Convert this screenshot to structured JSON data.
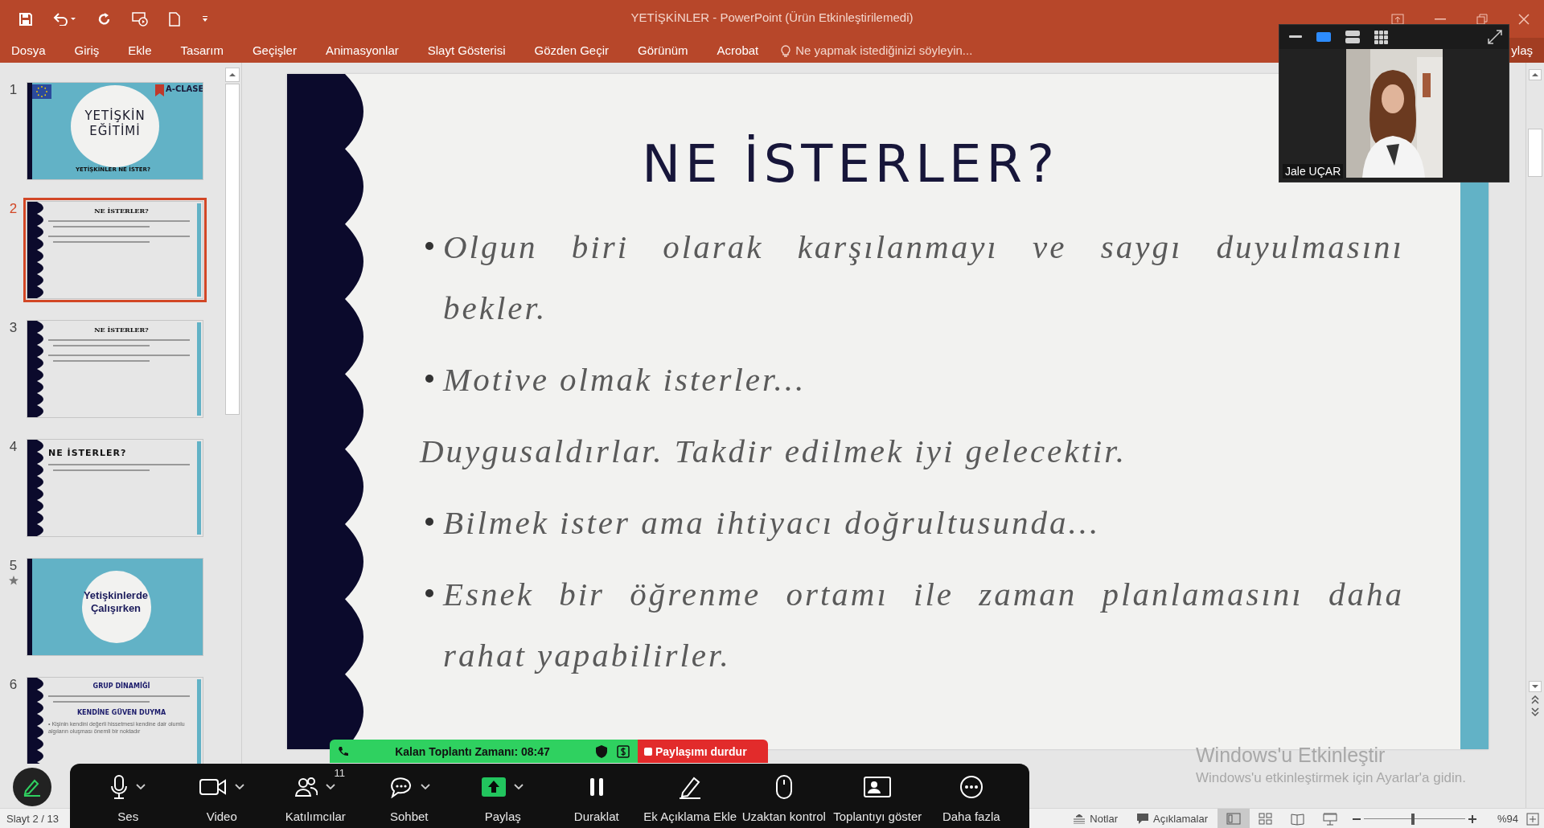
{
  "window": {
    "title": "YETİŞKİNLER - PowerPoint (Ürün Etkinleştirilemedi)"
  },
  "ribbon_tabs": [
    {
      "label": "Dosya"
    },
    {
      "label": "Giriş"
    },
    {
      "label": "Ekle"
    },
    {
      "label": "Tasarım"
    },
    {
      "label": "Geçişler"
    },
    {
      "label": "Animasyonlar"
    },
    {
      "label": "Slayt Gösterisi"
    },
    {
      "label": "Gözden Geçir"
    },
    {
      "label": "Görünüm"
    },
    {
      "label": "Acrobat"
    }
  ],
  "tell_me": {
    "placeholder": "Ne yapmak istediğinizi söyleyin..."
  },
  "share_button": "ylaş",
  "thumbnails": [
    {
      "number": "1",
      "kind": "title",
      "selected": false,
      "title_lines": [
        "YETİŞKİN",
        "EĞİTİMİ"
      ],
      "logo": "A-CLASE",
      "footer": "YETİŞKİNLER NE İSTER?"
    },
    {
      "number": "2",
      "kind": "content",
      "selected": true,
      "blocks": [
        {
          "kind": "heading-script",
          "text": "NE İSTERLER?"
        },
        {
          "kind": "lines"
        },
        {
          "kind": "lines"
        }
      ]
    },
    {
      "number": "3",
      "kind": "content",
      "selected": false,
      "blocks": [
        {
          "kind": "heading-script",
          "text": "NE İSTERLER?"
        },
        {
          "kind": "lines"
        },
        {
          "kind": "lines"
        }
      ]
    },
    {
      "number": "4",
      "kind": "content",
      "selected": false,
      "blocks": [
        {
          "kind": "heading-left",
          "text": "NE İSTERLER?"
        },
        {
          "kind": "lines"
        }
      ]
    },
    {
      "number": "5",
      "kind": "section",
      "selected": false,
      "animated": true,
      "title_lines": [
        "Yetişkinlerde",
        "Çalışırken"
      ]
    },
    {
      "number": "6",
      "kind": "content",
      "selected": false,
      "blocks": [
        {
          "kind": "heading-bold",
          "text": "GRUP DİNAMİĞİ"
        },
        {
          "kind": "lines"
        },
        {
          "kind": "heading-bold",
          "text": "KENDİNE GÜVEN DUYMA"
        },
        {
          "kind": "text",
          "text": "• Kişinin kendini değerli hissetmesi kendine dair olumlu algıların oluşması önemli bir noktadır"
        }
      ]
    }
  ],
  "slide": {
    "title": "NE İSTERLER?",
    "paragraphs": [
      {
        "kind": "bullet",
        "lines": [
          "Olgun biri olarak karşılanmayı ve saygı duyulmasını",
          "bekler."
        ]
      },
      {
        "kind": "bullet",
        "lines": [
          "Motive olmak isterler..."
        ]
      },
      {
        "kind": "plain",
        "lines": [
          "Duygusaldırlar. Takdir edilmek iyi gelecektir."
        ]
      },
      {
        "kind": "bullet",
        "lines": [
          "Bilmek ister ama ihtiyacı doğrultusunda..."
        ]
      },
      {
        "kind": "bullet",
        "lines": [
          "Esnek bir öğrenme ortamı ile zaman planlamasını daha",
          "rahat yapabilirler."
        ]
      }
    ]
  },
  "video": {
    "name": "Jale UÇAR",
    "layouts": [
      {
        "kind": "minimize",
        "selected": false
      },
      {
        "kind": "speaker",
        "selected": true
      },
      {
        "kind": "stack",
        "selected": false
      },
      {
        "kind": "grid",
        "selected": false
      }
    ]
  },
  "meeting_bar": {
    "timer": "Kalan Toplantı Zamanı: 08:47",
    "stop_share": "Paylaşımı durdur"
  },
  "toolbar": [
    {
      "kind": "mic",
      "label": "Ses",
      "menu": true
    },
    {
      "kind": "camera",
      "label": "Video",
      "menu": true
    },
    {
      "kind": "people",
      "label": "Katılımcılar",
      "count": "11",
      "menu": true
    },
    {
      "kind": "chat",
      "label": "Sohbet",
      "menu": true
    },
    {
      "kind": "share",
      "label": "Paylaş",
      "menu": true
    },
    {
      "kind": "pause",
      "label": "Duraklat",
      "menu": false
    },
    {
      "kind": "pen",
      "label": "Ek Açıklama Ekle",
      "menu": false
    },
    {
      "kind": "mouse",
      "label": "Uzaktan kontrol",
      "menu": false
    },
    {
      "kind": "screen",
      "label": "Toplantıyı göster",
      "menu": false
    },
    {
      "kind": "more",
      "label": "Daha fazla",
      "menu": false
    }
  ],
  "activation": {
    "title": "Windows'u Etkinleştir",
    "message": "Windows'u etkinleştirmek için Ayarlar'a gidin."
  },
  "status_bar": {
    "slide_info": "Slayt 2 / 13",
    "notes": "Notlar",
    "comments": "Açıklamalar",
    "views": [
      {
        "kind": "normal",
        "selected": true
      },
      {
        "kind": "sorter",
        "selected": false
      },
      {
        "kind": "reading",
        "selected": false
      },
      {
        "kind": "show",
        "selected": false
      }
    ],
    "zoom": {
      "level": 0.47,
      "value": "%94"
    }
  }
}
